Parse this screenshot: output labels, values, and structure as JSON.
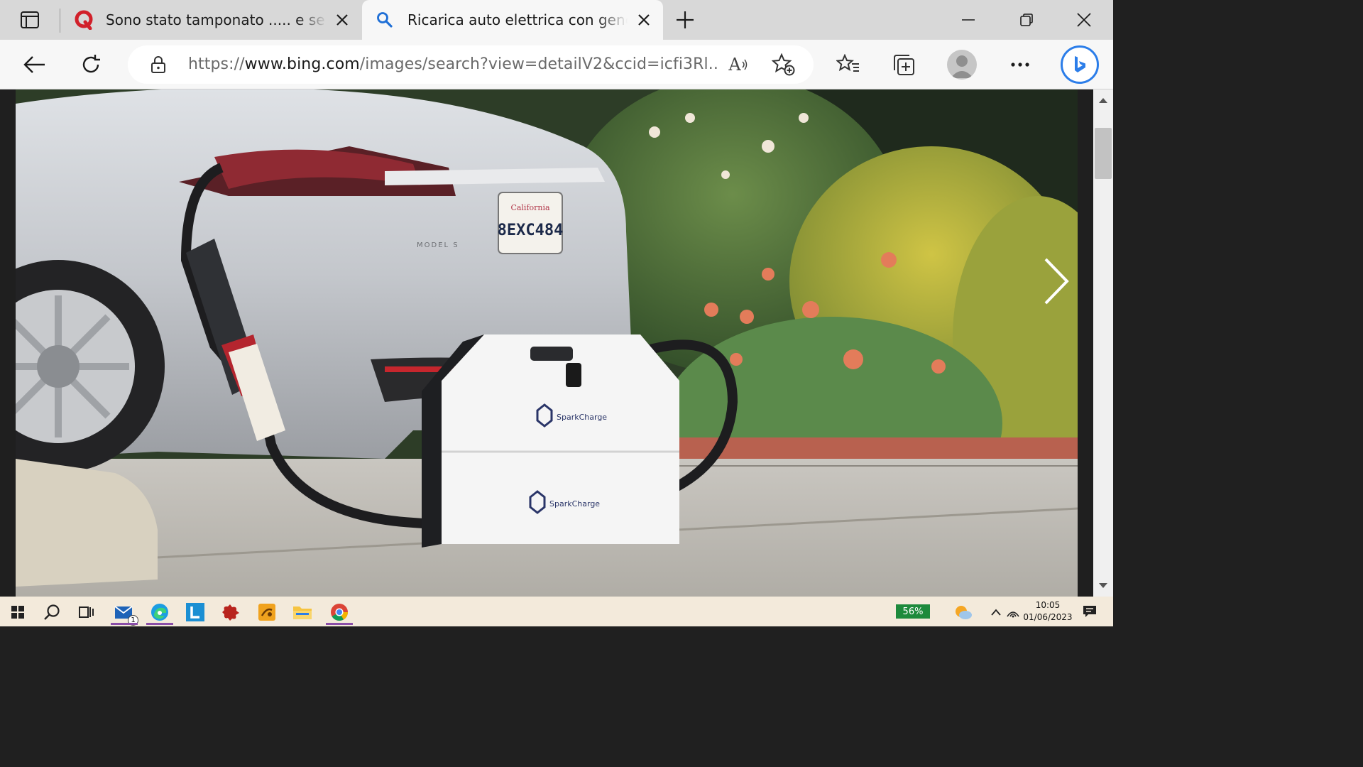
{
  "tabs": [
    {
      "title": "Sono stato tamponato ..... e se ca",
      "favicon": "quora-icon",
      "active": false
    },
    {
      "title": "Ricarica auto elettrica con genera",
      "favicon": "search-icon",
      "active": true
    }
  ],
  "addressbar": {
    "url_prefix": "https://",
    "url_host": "www.bing.com",
    "url_path": "/images/search?view=detailV2&ccid=icfi3Rl...",
    "read_aloud": "A"
  },
  "photo": {
    "plate_state": "California",
    "plate_number": "8EXC484",
    "car_badge": "MODEL S",
    "charger_brand": "SparkCharge",
    "charger_brand_lower": "SparkCharge"
  },
  "taskbar": {
    "mail_badge": "1",
    "battery": "56%",
    "time": "10:05",
    "date": "01/06/2023"
  },
  "colors": {
    "tab_strip": "#d8d8d8",
    "toolbar": "#f7f7f7",
    "bing_blue": "#2b7de9",
    "taskbar": "#f3eadb",
    "battery": "#1d8a3c"
  }
}
